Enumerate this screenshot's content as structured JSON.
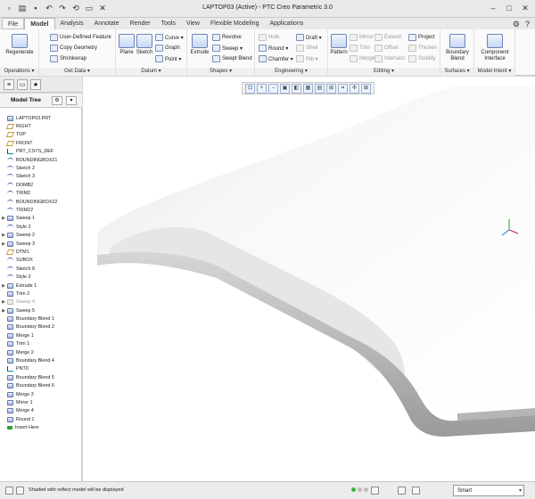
{
  "window": {
    "title": "LAPTOP03 (Active) - PTC Creo Parametric 3.0"
  },
  "tabs": [
    {
      "label": "File",
      "style": "file"
    },
    {
      "label": "Model",
      "style": "active"
    },
    {
      "label": "Analysis",
      "style": ""
    },
    {
      "label": "Annotate",
      "style": ""
    },
    {
      "label": "Render",
      "style": ""
    },
    {
      "label": "Tools",
      "style": ""
    },
    {
      "label": "View",
      "style": ""
    },
    {
      "label": "Flexible Modeling",
      "style": ""
    },
    {
      "label": "Applications",
      "style": ""
    }
  ],
  "ribbon": {
    "operations": {
      "label": "Operations ▾",
      "regenerate": "Regenerate"
    },
    "get_data": {
      "label": "Get Data ▾",
      "user_defined_feature": "User-Defined Feature",
      "copy_geometry": "Copy Geometry",
      "shrinkwrap": "Shrinkwrap"
    },
    "datum": {
      "label": "Datum ▾",
      "plane": "Plane",
      "sketch": "Sketch",
      "curve": "Curve ▾",
      "graph": "Graph",
      "point": "Point ▾"
    },
    "shapes": {
      "label": "Shapes ▾",
      "extrude": "Extrude",
      "revolve": "Revolve",
      "sweep": "Sweep ▾",
      "swept_blend": "Swept Blend"
    },
    "engineering": {
      "label": "Engineering ▾",
      "hole": "Hole",
      "round": "Round ▾",
      "chamfer": "Chamfer ▾",
      "draft": "Draft ▾",
      "shell": "Shell",
      "rib": "Rib ▾"
    },
    "editing": {
      "label": "Editing ▾",
      "pattern": "Pattern",
      "mirror": "Mirror",
      "trim": "Trim",
      "merge": "Merge",
      "extend": "Extend",
      "offset": "Offset",
      "intersect": "Intersect",
      "project": "Project",
      "thicken": "Thicken",
      "solidify": "Solidify"
    },
    "surfaces": {
      "label": "Surfaces ▾",
      "boundary_blend": "Boundary Blend"
    },
    "model_intent": {
      "label": "Model Intent ▾",
      "component_interface": "Component Interface"
    }
  },
  "model_tree": {
    "title": "Model Tree",
    "items": [
      {
        "label": "LAPTOP03.PRT",
        "icon": "part",
        "exp": ""
      },
      {
        "label": "RIGHT",
        "icon": "datum",
        "exp": ""
      },
      {
        "label": "TOP",
        "icon": "datum",
        "exp": ""
      },
      {
        "label": "FRONT",
        "icon": "datum",
        "exp": ""
      },
      {
        "label": "PRT_CSYS_DEF",
        "icon": "csys",
        "exp": ""
      },
      {
        "label": "BOUNDINGBOX21",
        "icon": "sketch",
        "exp": ""
      },
      {
        "label": "Sketch 2",
        "icon": "sketch",
        "exp": ""
      },
      {
        "label": "Sketch 3",
        "icon": "sketch",
        "exp": ""
      },
      {
        "label": "DOMB2",
        "icon": "sketch",
        "exp": ""
      },
      {
        "label": "TRIM2",
        "icon": "sketch",
        "exp": ""
      },
      {
        "label": "BOUNDINGBOX22",
        "icon": "sketch",
        "exp": ""
      },
      {
        "label": "TRIM22",
        "icon": "sketch",
        "exp": ""
      },
      {
        "label": "Sweep 1",
        "icon": "feat",
        "exp": "▶"
      },
      {
        "label": "Style 2",
        "icon": "sketch",
        "exp": ""
      },
      {
        "label": "Sweep 2",
        "icon": "feat",
        "exp": "▶"
      },
      {
        "label": "Sweep 3",
        "icon": "feat",
        "exp": "▶"
      },
      {
        "label": "DTM1",
        "icon": "datum",
        "exp": ""
      },
      {
        "label": "SUBOX",
        "icon": "sketch",
        "exp": ""
      },
      {
        "label": "Sketch 8",
        "icon": "sketch",
        "exp": ""
      },
      {
        "label": "Style 3",
        "icon": "sketch",
        "exp": ""
      },
      {
        "label": "Extrude 1",
        "icon": "feat",
        "exp": "▶"
      },
      {
        "label": "Trim 2",
        "icon": "feat",
        "exp": ""
      },
      {
        "label": "Sweep 4",
        "icon": "feat",
        "exp": "▶",
        "dim": true
      },
      {
        "label": "Sweep 5",
        "icon": "feat",
        "exp": "▶"
      },
      {
        "label": "Boundary Blend 1",
        "icon": "feat",
        "exp": ""
      },
      {
        "label": "Boundary Blend 2",
        "icon": "feat",
        "exp": ""
      },
      {
        "label": "Merge 1",
        "icon": "feat",
        "exp": ""
      },
      {
        "label": "Trim 1",
        "icon": "feat",
        "exp": ""
      },
      {
        "label": "Merge 2",
        "icon": "feat",
        "exp": ""
      },
      {
        "label": "Boundary Blend 4",
        "icon": "feat",
        "exp": ""
      },
      {
        "label": "PNT0",
        "icon": "csys",
        "exp": ""
      },
      {
        "label": "Boundary Blend 5",
        "icon": "feat",
        "exp": ""
      },
      {
        "label": "Boundary Blend 6",
        "icon": "feat",
        "exp": ""
      },
      {
        "label": "Merge 3",
        "icon": "feat",
        "exp": ""
      },
      {
        "label": "Mirror 1",
        "icon": "feat",
        "exp": ""
      },
      {
        "label": "Merge 4",
        "icon": "feat",
        "exp": ""
      },
      {
        "label": "Round 1",
        "icon": "feat",
        "exp": ""
      },
      {
        "label": "Insert Here",
        "icon": "insert",
        "exp": ""
      }
    ]
  },
  "status": {
    "message": "Shaded with reflect model will be displayed",
    "filter": "Smart"
  }
}
